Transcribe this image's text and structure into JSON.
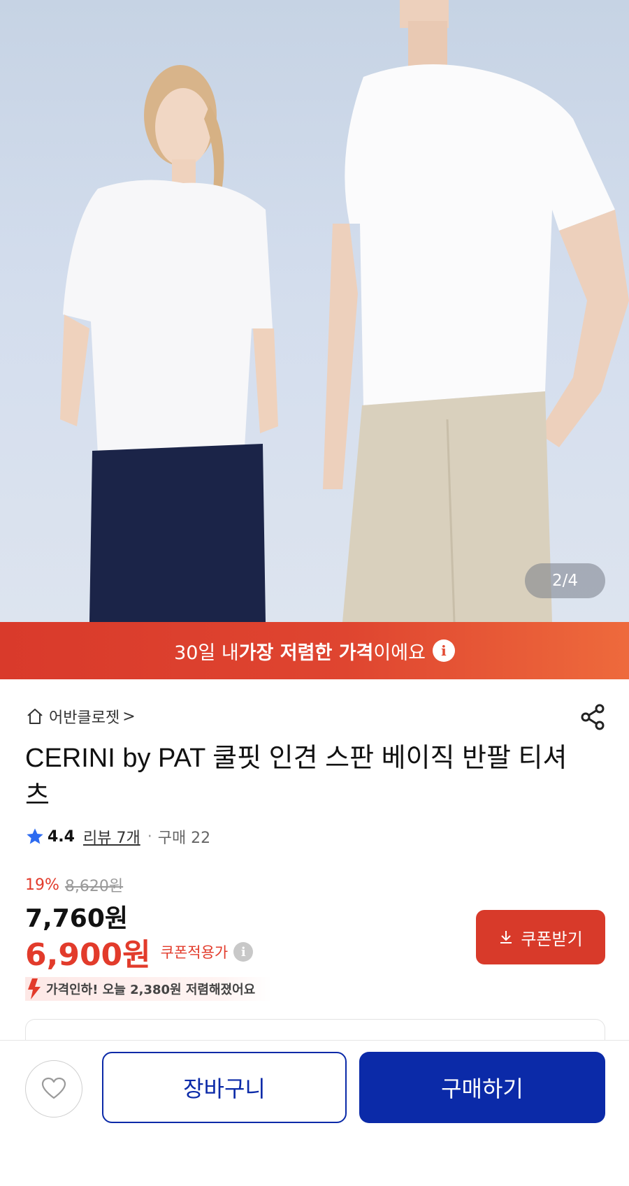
{
  "hero": {
    "image_counter": "2/4"
  },
  "banner": {
    "text_prefix": "30일 내 ",
    "text_bold": "가장 저렴한 가격",
    "text_suffix": "이에요",
    "info_glyph": "i",
    "color_start": "#d93a2b",
    "color_end": "#ee6a3c"
  },
  "store": {
    "name": "어반클로젯",
    "chevron": ">"
  },
  "product": {
    "title": "CERINI by PAT 쿨핏 인견 스판 베이직 반팔 티셔츠",
    "rating": "4.4",
    "review_label": "리뷰 7개",
    "separator": "·",
    "purchase_label": "구매 22"
  },
  "pricing": {
    "discount_percent": "19%",
    "original_price": "8,620원",
    "sale_price": "7,760원",
    "coupon_price": "6,900원",
    "coupon_label": "쿠폰적용가",
    "coupon_info_glyph": "i",
    "coupon_button": "쿠폰받기",
    "price_drop_note": "가격인하! 오늘 2,380원 저렴해졌어요",
    "accent_color": "#e23b2b"
  },
  "bottom_bar": {
    "cart_label": "장바구니",
    "buy_label": "구매하기",
    "primary_color": "#0b2aa8"
  }
}
